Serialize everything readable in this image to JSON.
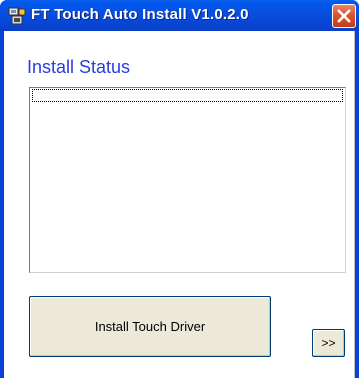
{
  "window": {
    "title": "FT Touch Auto Install V1.0.2.0",
    "icon": "installer-app-icon",
    "close_icon": "close-icon",
    "close_color": "#d9542e",
    "titlebar_color": "#0a4fe0"
  },
  "main": {
    "section_title": "Install Status",
    "section_title_color": "#2a3cdc",
    "status_log": "",
    "install_button_label": "Install Touch Driver",
    "more_button_label": ">>"
  }
}
